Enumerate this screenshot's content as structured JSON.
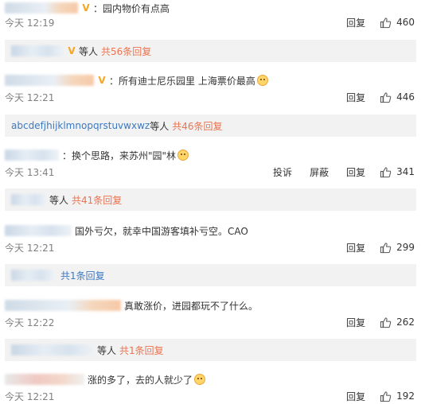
{
  "comments": [
    {
      "text": "：园内物价有点高",
      "time": "今天 12:19",
      "reply_action": "回复",
      "likes": "460",
      "replies": {
        "suffix": "等人",
        "link": "共56条回复"
      }
    },
    {
      "text": "：所有迪士尼乐园里 上海票价最高",
      "time": "今天 12:21",
      "reply_action": "回复",
      "likes": "446",
      "replies": {
        "user": "abcdefjhijklmnopqrstuvwxwz",
        "suffix": "等人",
        "link": "共46条回复"
      }
    },
    {
      "text": "：换个思路，来苏州\"园\"林",
      "time": "今天 13:41",
      "report_action": "投诉",
      "block_action": "屏蔽",
      "reply_action": "回复",
      "likes": "341",
      "replies": {
        "suffix": "等人",
        "link": "共41条回复"
      }
    },
    {
      "text": "国外亏欠，就幸中国游客填补亏空。CAO",
      "time": "今天 12:21",
      "reply_action": "回复",
      "likes": "299",
      "replies": {
        "link": "共1条回复"
      }
    },
    {
      "text": "真敢涨价，进园都玩不了什么。",
      "time": "今天 12:22",
      "reply_action": "回复",
      "likes": "262",
      "replies": {
        "suffix": "等人",
        "link": "共1条回复"
      }
    },
    {
      "text": "涨的多了，去的人就少了",
      "time": "今天 12:21",
      "reply_action": "回复",
      "likes": "192"
    }
  ]
}
